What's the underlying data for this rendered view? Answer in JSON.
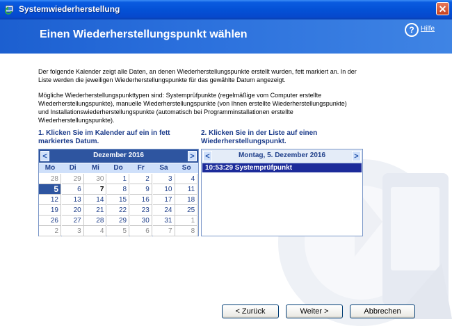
{
  "window": {
    "title": "Systemwiederherstellung",
    "close_label": "✕"
  },
  "header": {
    "title": "Einen Wiederherstellungspunkt wählen",
    "help_label": "Hilfe"
  },
  "intro": {
    "p1": "Der folgende Kalender zeigt alle Daten, an denen Wiederherstellungspunkte erstellt wurden, fett markiert an. In der Liste werden die jeweiligen Wiederherstellungspunkte für das gewählte Datum angezeigt.",
    "p2": "Mögliche Wiederherstellungspunkttypen sind: Systemprüfpunkte (regelmäßige vom Computer erstellte Wiederherstellungspunkte), manuelle Wiederherstellungspunkte (von Ihnen erstellte Wiederherstellungspunkte) und Installationswiederherstellungspunkte (automatisch bei Programminstallationen erstellte Wiederherstellungspunkte)."
  },
  "step1": "1. Klicken Sie im Kalender auf ein in fett markiertes Datum.",
  "step2": "2. Klicken Sie in der Liste auf einen Wiederherstellungspunkt.",
  "calendar": {
    "month_label": "Dezember 2016",
    "prev": "<",
    "next": ">",
    "weekdays": [
      "Mo",
      "Di",
      "Mi",
      "Do",
      "Fr",
      "Sa",
      "So"
    ],
    "weeks": [
      [
        "28",
        "29",
        "30",
        "1",
        "2",
        "3",
        "4"
      ],
      [
        "5",
        "6",
        "7",
        "8",
        "9",
        "10",
        "11"
      ],
      [
        "12",
        "13",
        "14",
        "15",
        "16",
        "17",
        "18"
      ],
      [
        "19",
        "20",
        "21",
        "22",
        "23",
        "24",
        "25"
      ],
      [
        "26",
        "27",
        "28",
        "29",
        "30",
        "31",
        "1"
      ],
      [
        "2",
        "3",
        "4",
        "5",
        "6",
        "7",
        "8"
      ]
    ],
    "selected_day": "5",
    "bold_days": [
      "7"
    ]
  },
  "restore_list": {
    "date_label": "Montag, 5. Dezember 2016",
    "prev": "<",
    "next": ">",
    "items": [
      {
        "label": "10:53:29  Systemprüfpunkt"
      }
    ]
  },
  "buttons": {
    "back": "< Zurück",
    "next": "Weiter >",
    "cancel": "Abbrechen"
  }
}
